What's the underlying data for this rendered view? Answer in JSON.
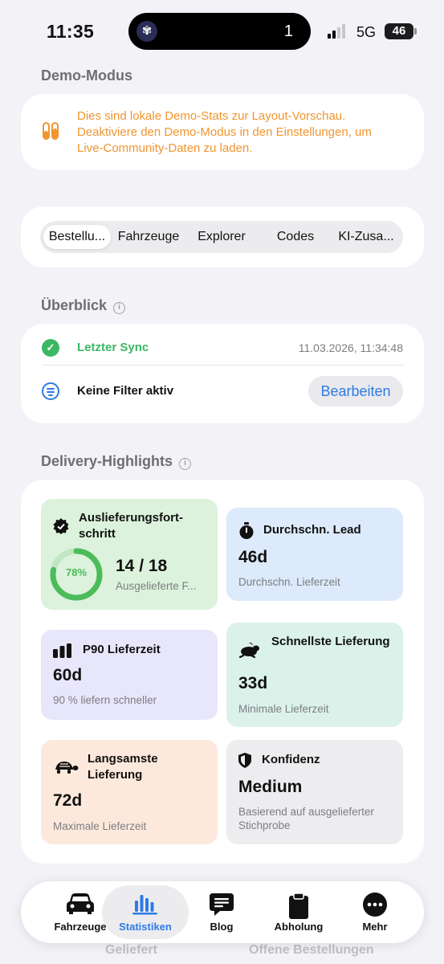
{
  "status_bar": {
    "time": "11:35",
    "island_count": "1",
    "network": "5G",
    "battery": "46"
  },
  "demo": {
    "title": "Demo-Modus",
    "text": "Dies sind lokale Demo-Stats zur Layout-Vorschau. Deaktiviere den Demo-Modus in den Einstellungen, um Live-Community-Daten zu laden.",
    "icon": "test-tubes-icon",
    "color": "#f0952f"
  },
  "segments": {
    "items": [
      "Bestellu...",
      "Fahrzeuge",
      "Explorer",
      "Codes",
      "KI-Zusa..."
    ],
    "active": "Bestellu..."
  },
  "overview": {
    "title": "Überblick",
    "sync_label": "Letzter Sync",
    "sync_value": "11.03.2026, 11:34:48",
    "filter_label": "Keine Filter aktiv",
    "edit_label": "Bearbeiten"
  },
  "highlights": {
    "title": "Delivery-Highlights",
    "progress": {
      "title": "Auslieferungsfort-schritt",
      "percent_label": "78%",
      "percent": 0.78,
      "value": "14 / 18",
      "sub": "Ausgelieferte F..."
    },
    "lead": {
      "title": "Durchschn. Lead",
      "value": "46d",
      "sub": "Durchschn. Lieferzeit"
    },
    "p90": {
      "title": "P90 Lieferzeit",
      "value": "60d",
      "sub": "90 % liefern schneller"
    },
    "fastest": {
      "title": "Schnellste Lieferung",
      "value": "33d",
      "sub": "Minimale Lieferzeit"
    },
    "slowest": {
      "title": "Langsamste Lieferung",
      "value": "72d",
      "sub": "Maximale Lieferzeit"
    },
    "confidence": {
      "title": "Konfidenz",
      "value": "Medium",
      "sub": "Basierend auf ausgelieferter Stichprobe"
    }
  },
  "tabbar": {
    "items": [
      "Fahrzeuge",
      "Statistiken",
      "Blog",
      "Abholung",
      "Mehr"
    ],
    "active": "Statistiken",
    "accent": "#2f7be5"
  },
  "below_fold": {
    "left": "Geliefert",
    "right": "Offene Bestellungen"
  }
}
